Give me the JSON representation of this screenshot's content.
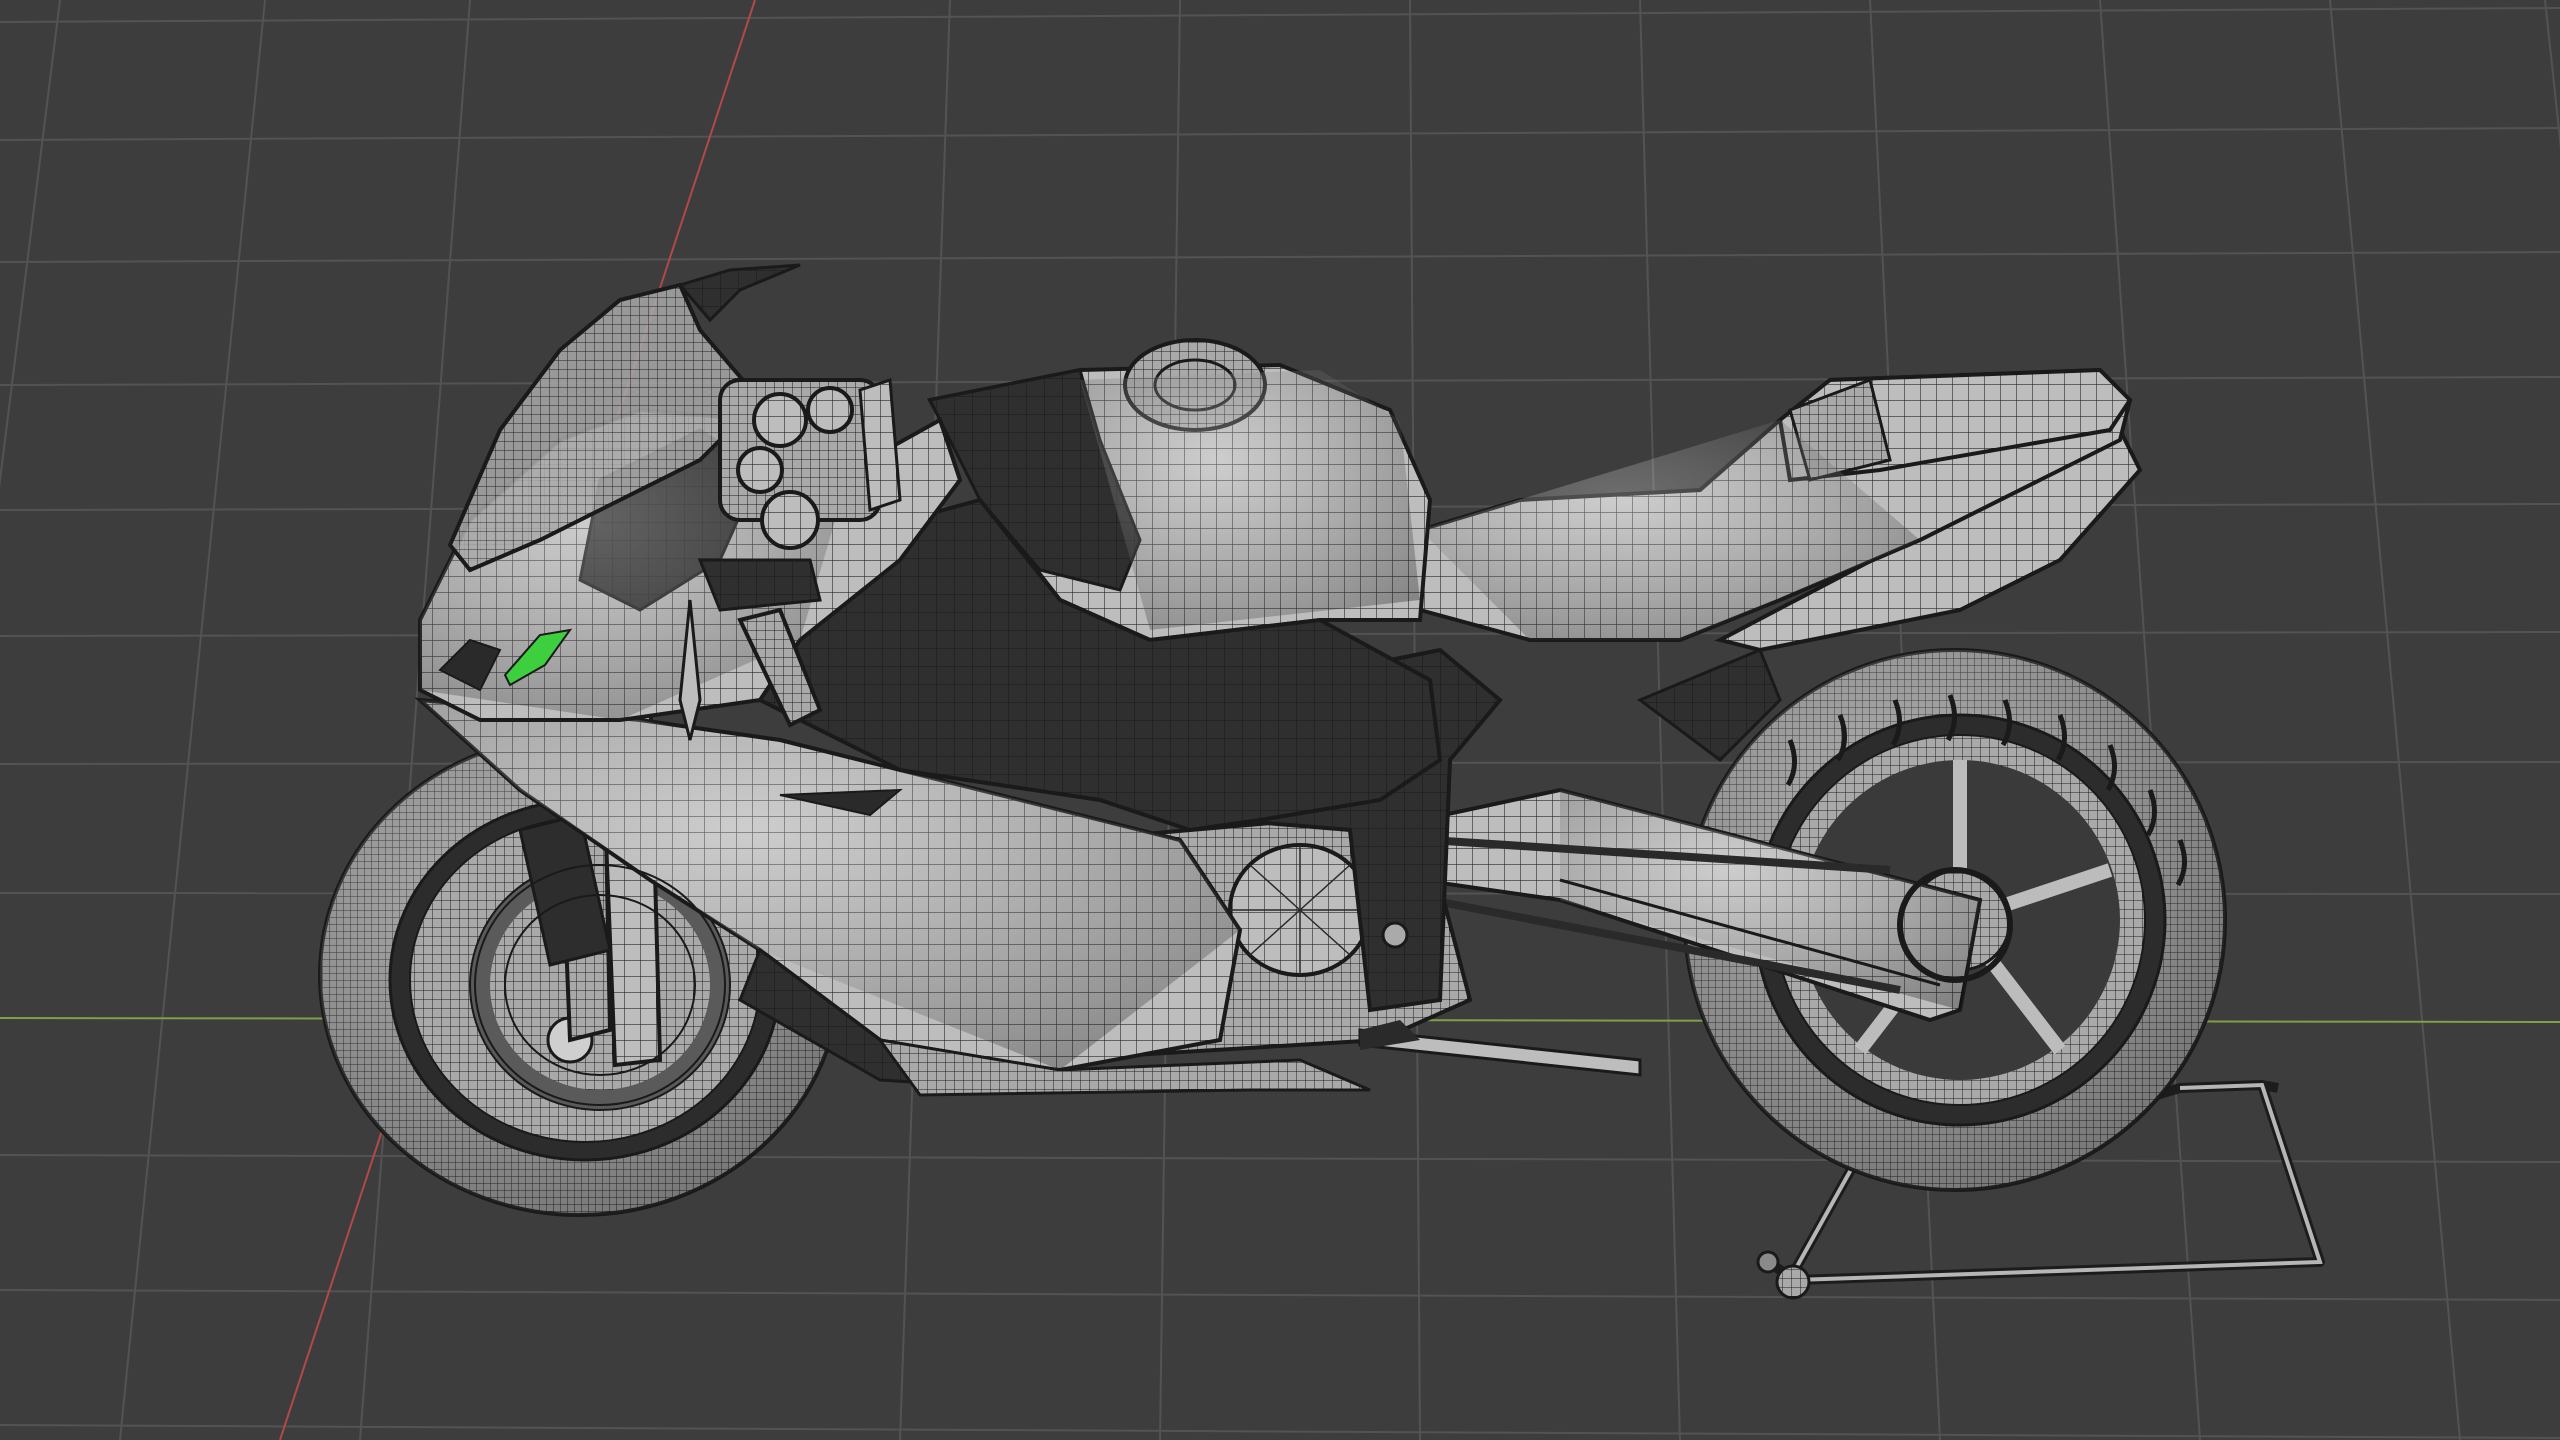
{
  "viewport": {
    "mode": "wireframe-overlay",
    "shading": "solid",
    "background_color": "#3d3d3d",
    "grid_color": "#535353",
    "axis_x_color": "#7fa046",
    "axis_y_color": "#b04a4a",
    "mesh_base_color": "#c8c8c8",
    "mesh_dark_color": "#2a2a2a",
    "wire_color": "#1a1a1a",
    "selected_face_color": "#3ecf3e"
  },
  "scene": {
    "object": "motorcycle",
    "objects": [
      "fairing",
      "windscreen",
      "fuel-tank",
      "seat",
      "tail",
      "front-wheel",
      "rear-wheel",
      "fork",
      "swingarm",
      "engine",
      "exhaust",
      "paddock-stand",
      "handlebar",
      "frame"
    ]
  }
}
